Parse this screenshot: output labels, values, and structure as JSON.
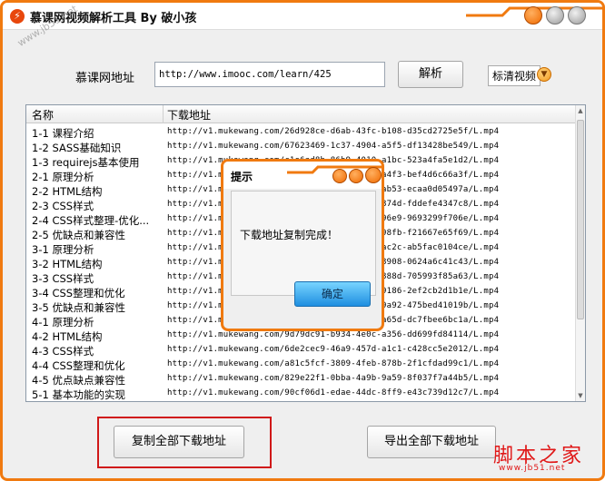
{
  "window": {
    "title": "慕课网视频解析工具 By 破小孩",
    "watermark": "www.jb51.net"
  },
  "url_row": {
    "label": "慕课网地址",
    "value": "http://www.imooc.com/learn/425",
    "parse_label": "解析",
    "quality_value": "标清视频"
  },
  "table": {
    "headers": [
      "名称",
      "下载地址"
    ],
    "rows": [
      {
        "name": "1-1 课程介绍",
        "url": "http://v1.mukewang.com/26d928ce-d6ab-43fc-b108-d35cd2725e5f/L.mp4"
      },
      {
        "name": "1-2 SASS基础知识",
        "url": "http://v1.mukewang.com/67623469-1c37-4904-a5f5-df13428be549/L.mp4"
      },
      {
        "name": "1-3 requirejs基本使用",
        "url": "http://v1.mukewang.com/c1e6ad8b-86b9-4010-a1bc-523a4fa5e1d2/L.mp4"
      },
      {
        "name": "2-1 原理分析",
        "url": "http://v1.mukewang.com/3c0d51c2-3e3f-4e1a-a4f3-bef4d6c66a3f/L.mp4"
      },
      {
        "name": "2-2 HTML结构",
        "url": "http://v1.mukewang.com/1f8a4d77-52b1-4c53-ab53-ecaa0d05497a/L.mp4"
      },
      {
        "name": "2-3 CSS样式",
        "url": "http://v1.mukewang.com/7a2e9b10-4d3c-4f88-874d-fddefe4347c8/L.mp4"
      },
      {
        "name": "2-4 CSS样式整理-优化...",
        "url": "http://v1.mukewang.com/b41c3a22-8e6f-4b21-96e9-9693299f706e/L.mp4"
      },
      {
        "name": "2-5 优缺点和兼容性",
        "url": "http://v1.mukewang.com/e90d4f13-6a2b-4c77-98fb-f21667e65f69/L.mp4"
      },
      {
        "name": "3-1 原理分析",
        "url": "http://v1.mukewang.com/5b7e8c31-2f40-4d1a-ac2c-ab5fac0104ce/L.mp4"
      },
      {
        "name": "3-2 HTML结构",
        "url": "http://v1.mukewang.com/c3f29a80-7d15-4e63-8908-0624a6c41c43/L.mp4"
      },
      {
        "name": "3-3 CSS样式",
        "url": "http://v1.mukewang.com/49a1e6d2-3b8c-4f07-888d-705993f85a63/L.mp4"
      },
      {
        "name": "3-4 CSS整理和优化",
        "url": "http://v1.mukewang.com/8d2c5f64-1e9a-4b30-9186-2ef2cb2d1b1e/L.mp4"
      },
      {
        "name": "3-5 优缺点和兼容性",
        "url": "http://v1.mukewang.com/0f6b3a95-4c72-4d8e-9a92-475bed41019b/L.mp4"
      },
      {
        "name": "4-1 原理分析",
        "url": "http://v1.mukewang.com/a7e40c18-9b63-4f25-a65d-dc7fbee6bc1a/L.mp4"
      },
      {
        "name": "4-2 HTML结构",
        "url": "http://v1.mukewang.com/9d79dc91-b934-4e0c-a356-dd699fd84114/L.mp4"
      },
      {
        "name": "4-3 CSS样式",
        "url": "http://v1.mukewang.com/6de2cec9-46a9-457d-a1c1-c428cc5e2012/L.mp4"
      },
      {
        "name": "4-4 CSS整理和优化",
        "url": "http://v1.mukewang.com/a81c5fcf-3809-4feb-878b-2f1cfdad99c1/L.mp4"
      },
      {
        "name": "4-5 优点缺点兼容性",
        "url": "http://v1.mukewang.com/829e22f1-0bba-4a9b-9a59-8f037f7a44b5/L.mp4"
      },
      {
        "name": "5-1 基本功能的实现",
        "url": "http://v1.mukewang.com/90cf06d1-edae-44dc-8ff9-e43c739d12c7/L.mp4"
      }
    ]
  },
  "actions": {
    "copy_all_label": "复制全部下载地址",
    "export_all_label": "导出全部下载地址"
  },
  "brand": {
    "name": "脚本之家",
    "url": "www.jb51.net"
  },
  "dialog": {
    "title": "提示",
    "message": "下载地址复制完成！",
    "ok_label": "确定"
  },
  "colors": {
    "accent": "#f07a10",
    "highlight_box": "#d01818",
    "brand": "#e01818"
  }
}
